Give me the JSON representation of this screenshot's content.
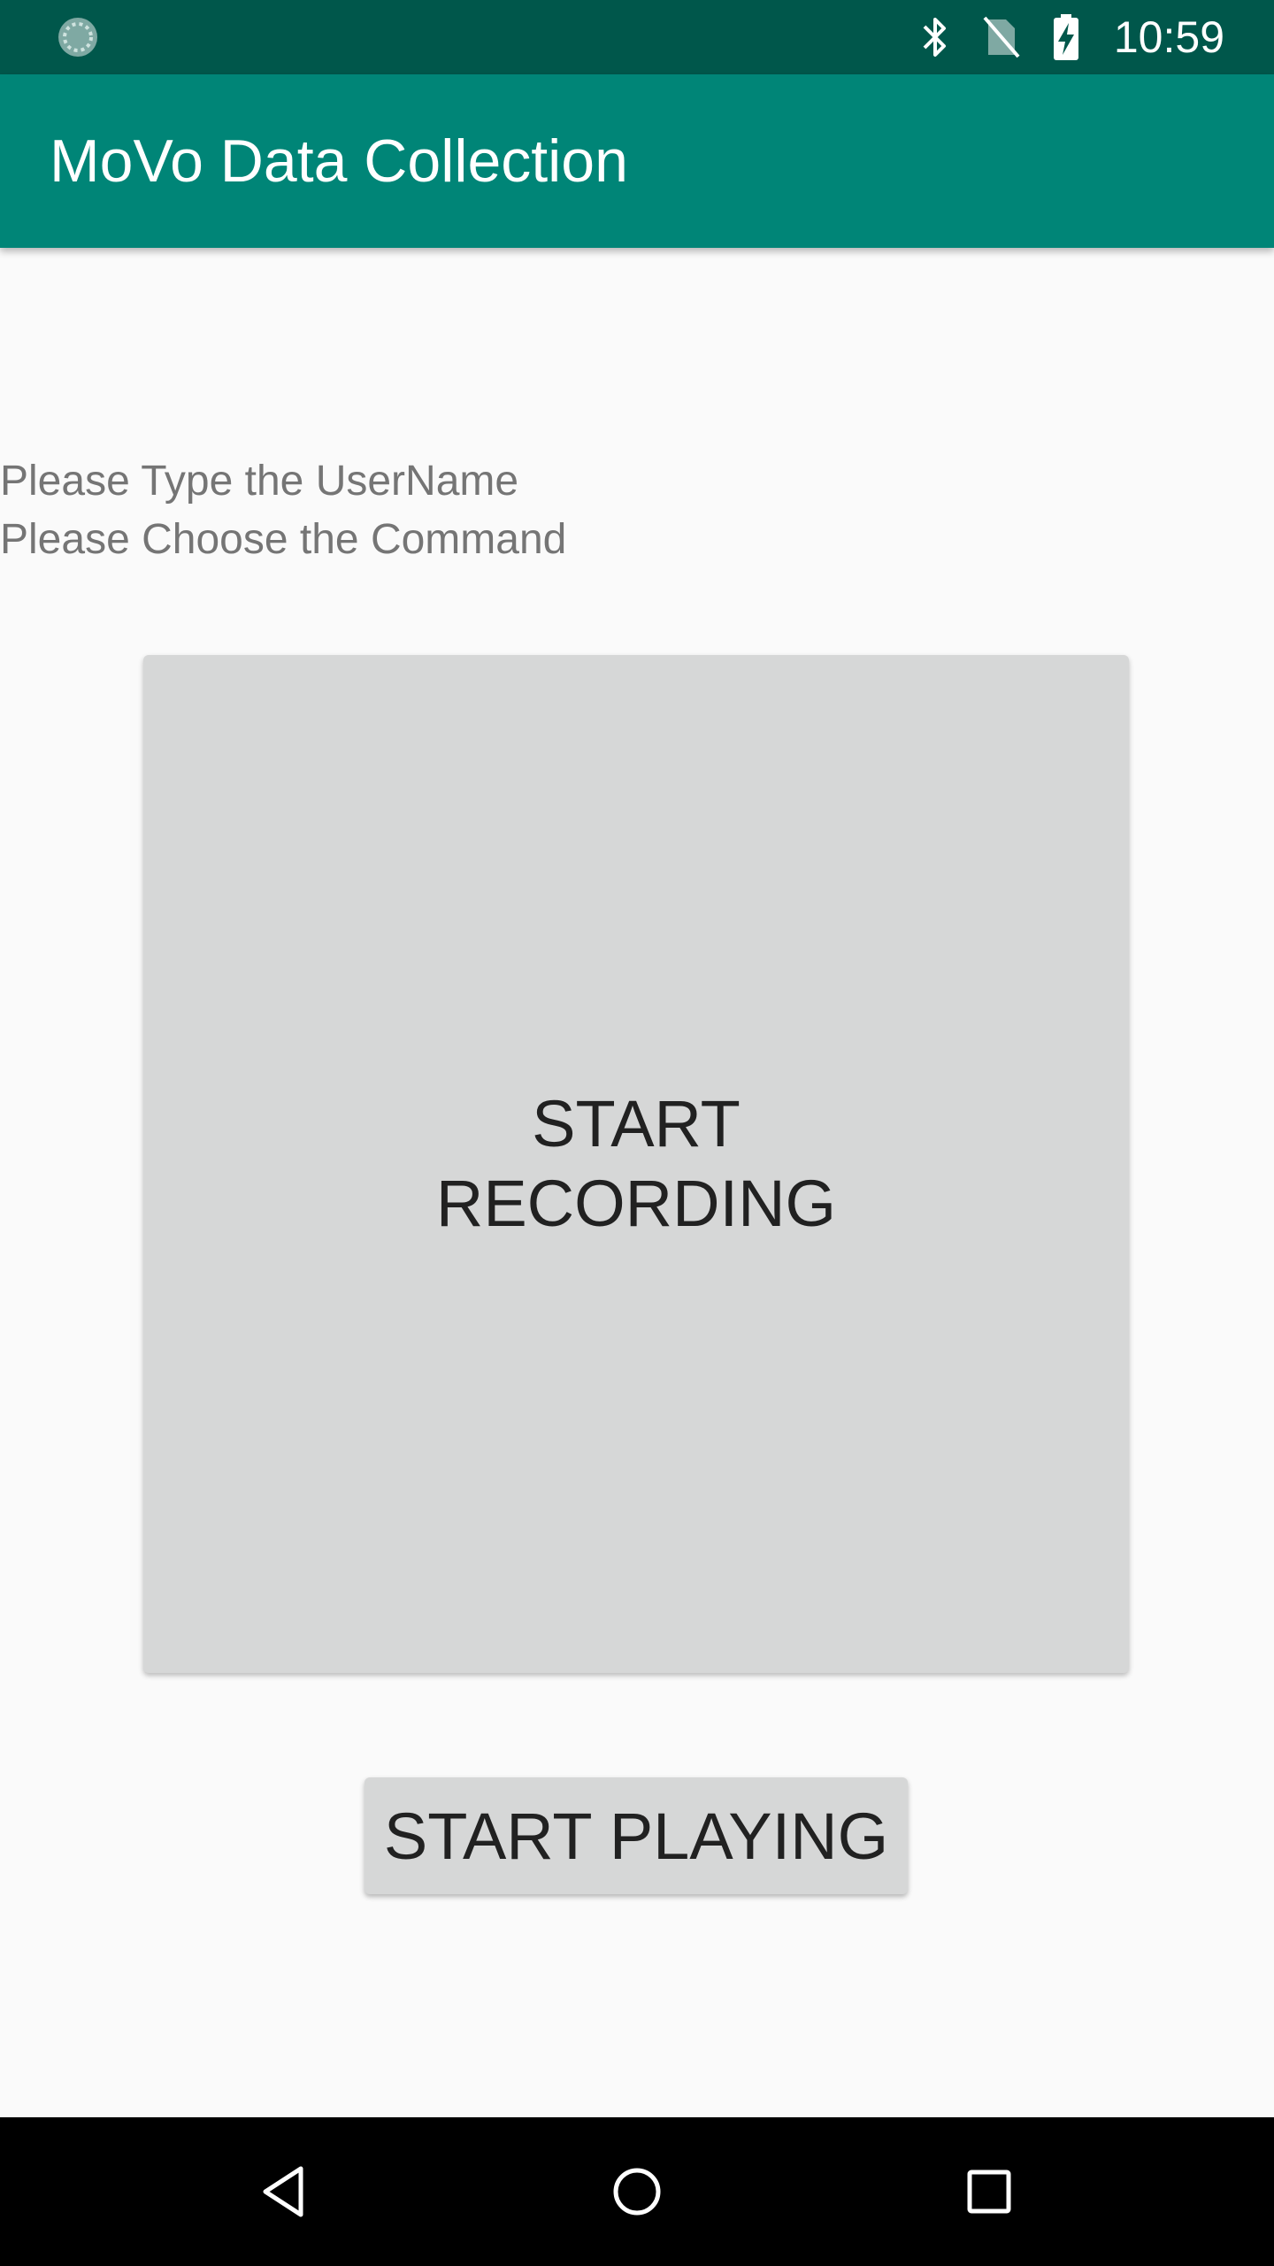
{
  "status_bar": {
    "time": "10:59",
    "icons": [
      "sync-icon",
      "bluetooth-icon",
      "no-sim-icon",
      "battery-charging-icon"
    ],
    "background": "#00574b"
  },
  "app_bar": {
    "title": "MoVo Data Collection",
    "background": "#008577"
  },
  "content": {
    "username_prompt": "Please Type the UserName",
    "command_prompt": "Please Choose the Command",
    "record_button_label": "START RECORDING",
    "play_button_label": "START PLAYING"
  },
  "nav_bar": {
    "buttons": [
      "back-icon",
      "home-icon",
      "recents-icon"
    ]
  }
}
